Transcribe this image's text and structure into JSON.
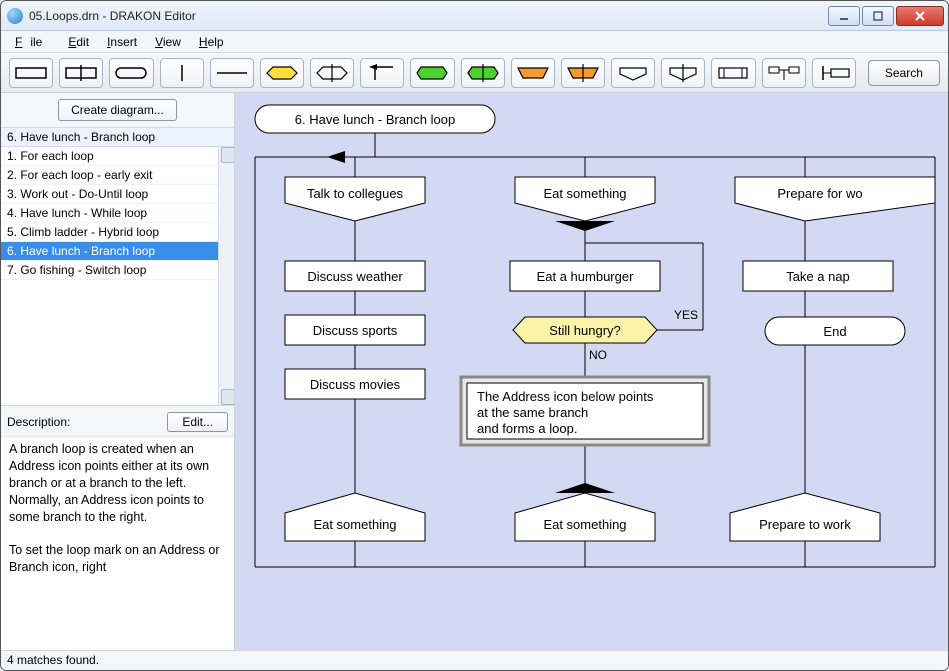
{
  "window": {
    "title": "05.Loops.drn - DRAKON Editor"
  },
  "menu": {
    "file": "File",
    "edit": "Edit",
    "insert": "Insert",
    "view": "View",
    "help": "Help"
  },
  "toolbar": {
    "icons": [
      "action",
      "action-split",
      "terminator",
      "vline",
      "hline",
      "question",
      "question-alt",
      "back-arrow",
      "begin",
      "begin-mark",
      "case",
      "case-alt",
      "output",
      "input",
      "module",
      "tree",
      "loop"
    ],
    "search": "Search"
  },
  "sidebar": {
    "create": "Create diagram...",
    "header": "6. Have lunch - Branch loop",
    "items": [
      "1. For each loop",
      "2. For each loop - early exit",
      "3. Work out - Do-Until loop",
      "4. Have lunch - While loop",
      "5. Climb ladder - Hybrid loop",
      "6. Have lunch - Branch loop",
      "7. Go fishing - Switch loop"
    ],
    "selected_index": 5,
    "desc_label": "Description:",
    "edit_label": "Edit...",
    "description": "A branch loop is created when an Address icon points either at its own branch or at a branch to the left.\nNormally, an Address icon points to some branch to the right.\n\nTo set the loop mark on an Address or Branch icon, right"
  },
  "statusbar": {
    "text": "4 matches found."
  },
  "diagram": {
    "title": "6. Have lunch - Branch loop",
    "branches": [
      {
        "header": "Talk to collegues",
        "actions": [
          "Discuss weather",
          "Discuss sports",
          "Discuss movies"
        ],
        "address": "Eat something"
      },
      {
        "header": "Eat something",
        "actions": [
          "Eat a humburger"
        ],
        "question": {
          "text": "Still hungry?",
          "yes": "YES",
          "no": "NO"
        },
        "comment": "The Address icon below points\nat the same branch\nand forms a loop.",
        "address": "Eat something"
      },
      {
        "header": "Prepare for wo",
        "actions": [
          "Take a nap"
        ],
        "end": "End",
        "address": "Prepare to work"
      }
    ]
  }
}
